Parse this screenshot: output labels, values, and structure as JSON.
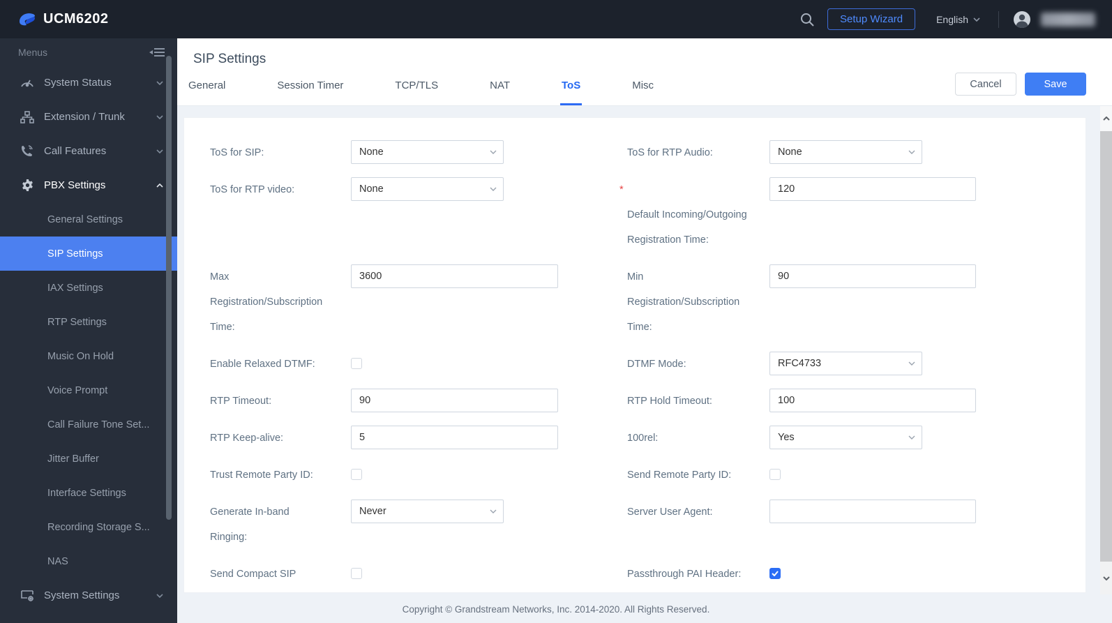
{
  "topbar": {
    "device_name": "UCM6202",
    "setup_wizard_label": "Setup Wizard",
    "language_label": "English"
  },
  "sidebar": {
    "menus_label": "Menus",
    "top_items": [
      {
        "label": "System Status",
        "icon": "gauge-icon",
        "expanded": false
      },
      {
        "label": "Extension / Trunk",
        "icon": "sitemap-icon",
        "expanded": false
      },
      {
        "label": "Call Features",
        "icon": "phone-icon",
        "expanded": false
      },
      {
        "label": "PBX Settings",
        "icon": "gear-icon",
        "expanded": true
      }
    ],
    "sub_items": [
      {
        "label": "General Settings",
        "selected": false
      },
      {
        "label": "SIP Settings",
        "selected": true
      },
      {
        "label": "IAX Settings",
        "selected": false
      },
      {
        "label": "RTP Settings",
        "selected": false
      },
      {
        "label": "Music On Hold",
        "selected": false
      },
      {
        "label": "Voice Prompt",
        "selected": false
      },
      {
        "label": "Call Failure Tone Set...",
        "selected": false
      },
      {
        "label": "Jitter Buffer",
        "selected": false
      },
      {
        "label": "Interface Settings",
        "selected": false
      },
      {
        "label": "Recording Storage S...",
        "selected": false
      },
      {
        "label": "NAS",
        "selected": false
      }
    ],
    "bottom_items": [
      {
        "label": "System Settings",
        "icon": "monitor-gear-icon",
        "expanded": false
      }
    ]
  },
  "page": {
    "title": "SIP Settings",
    "tabs": [
      "General",
      "Session Timer",
      "TCP/TLS",
      "NAT",
      "ToS",
      "Misc"
    ],
    "active_tab": "ToS",
    "cancel_label": "Cancel",
    "save_label": "Save"
  },
  "form": {
    "required_marker": "*",
    "left": [
      {
        "label": "ToS for SIP:",
        "type": "select",
        "value": "None"
      },
      {
        "label": "ToS for RTP video:",
        "type": "select",
        "value": "None"
      },
      {
        "label": "Max\nRegistration/Subscription\nTime:",
        "type": "input",
        "value": "3600"
      },
      {
        "label": "Enable Relaxed DTMF:",
        "type": "checkbox",
        "checked": false
      },
      {
        "label": "RTP Timeout:",
        "type": "input",
        "value": "90"
      },
      {
        "label": "RTP Keep-alive:",
        "type": "input",
        "value": "5",
        "highlighted": true
      },
      {
        "label": "Trust Remote Party ID:",
        "type": "checkbox",
        "checked": false
      },
      {
        "label": "Generate In-band\nRinging:",
        "type": "select",
        "value": "Never"
      },
      {
        "label": "Send Compact SIP\nHeaders:",
        "type": "checkbox",
        "checked": false
      }
    ],
    "right": [
      {
        "label": "ToS for RTP Audio:",
        "type": "select",
        "value": "None"
      },
      {
        "label": "Default Incoming/Outgoing\nRegistration Time:",
        "type": "input",
        "value": "120",
        "required": true
      },
      {
        "label": "Min\nRegistration/Subscription\nTime:",
        "type": "input",
        "value": "90"
      },
      {
        "label": "DTMF Mode:",
        "type": "select",
        "value": "RFC4733"
      },
      {
        "label": "RTP Hold Timeout:",
        "type": "input",
        "value": "100"
      },
      {
        "label": "100rel:",
        "type": "select",
        "value": "Yes"
      },
      {
        "label": "Send Remote Party ID:",
        "type": "checkbox",
        "checked": false
      },
      {
        "label": "Server User Agent:",
        "type": "input",
        "value": ""
      },
      {
        "label": "Passthrough PAI Header:",
        "type": "checkbox",
        "checked": true
      }
    ]
  },
  "footer": {
    "copyright": "Copyright © Grandstream Networks, Inc. 2014-2020. All Rights Reserved."
  },
  "colors": {
    "topbar_bg": "#1c222c",
    "sidebar_bg": "#272e3a",
    "sidebar_selected": "#4c80f0",
    "accent_blue": "#2d6bf4",
    "save_button": "#3f7ef4",
    "highlight_red": "#e60000"
  }
}
